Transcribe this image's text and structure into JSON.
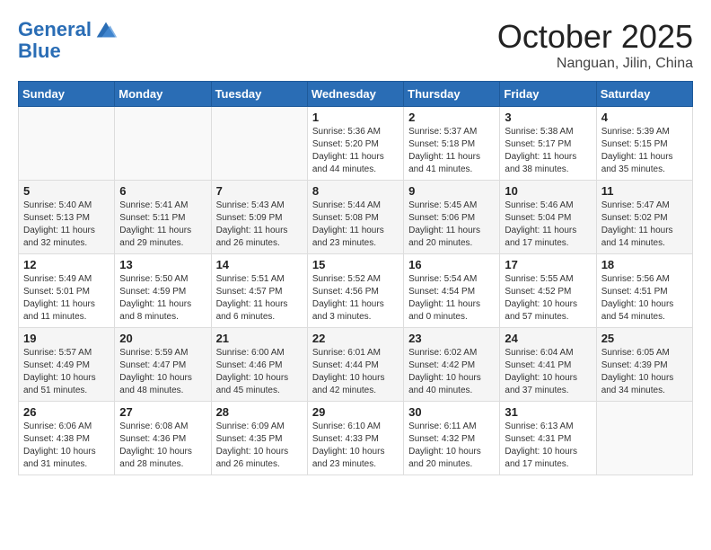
{
  "header": {
    "logo_line1": "General",
    "logo_line2": "Blue",
    "month": "October 2025",
    "location": "Nanguan, Jilin, China"
  },
  "weekdays": [
    "Sunday",
    "Monday",
    "Tuesday",
    "Wednesday",
    "Thursday",
    "Friday",
    "Saturday"
  ],
  "weeks": [
    [
      {
        "day": "",
        "info": ""
      },
      {
        "day": "",
        "info": ""
      },
      {
        "day": "",
        "info": ""
      },
      {
        "day": "1",
        "info": "Sunrise: 5:36 AM\nSunset: 5:20 PM\nDaylight: 11 hours\nand 44 minutes."
      },
      {
        "day": "2",
        "info": "Sunrise: 5:37 AM\nSunset: 5:18 PM\nDaylight: 11 hours\nand 41 minutes."
      },
      {
        "day": "3",
        "info": "Sunrise: 5:38 AM\nSunset: 5:17 PM\nDaylight: 11 hours\nand 38 minutes."
      },
      {
        "day": "4",
        "info": "Sunrise: 5:39 AM\nSunset: 5:15 PM\nDaylight: 11 hours\nand 35 minutes."
      }
    ],
    [
      {
        "day": "5",
        "info": "Sunrise: 5:40 AM\nSunset: 5:13 PM\nDaylight: 11 hours\nand 32 minutes."
      },
      {
        "day": "6",
        "info": "Sunrise: 5:41 AM\nSunset: 5:11 PM\nDaylight: 11 hours\nand 29 minutes."
      },
      {
        "day": "7",
        "info": "Sunrise: 5:43 AM\nSunset: 5:09 PM\nDaylight: 11 hours\nand 26 minutes."
      },
      {
        "day": "8",
        "info": "Sunrise: 5:44 AM\nSunset: 5:08 PM\nDaylight: 11 hours\nand 23 minutes."
      },
      {
        "day": "9",
        "info": "Sunrise: 5:45 AM\nSunset: 5:06 PM\nDaylight: 11 hours\nand 20 minutes."
      },
      {
        "day": "10",
        "info": "Sunrise: 5:46 AM\nSunset: 5:04 PM\nDaylight: 11 hours\nand 17 minutes."
      },
      {
        "day": "11",
        "info": "Sunrise: 5:47 AM\nSunset: 5:02 PM\nDaylight: 11 hours\nand 14 minutes."
      }
    ],
    [
      {
        "day": "12",
        "info": "Sunrise: 5:49 AM\nSunset: 5:01 PM\nDaylight: 11 hours\nand 11 minutes."
      },
      {
        "day": "13",
        "info": "Sunrise: 5:50 AM\nSunset: 4:59 PM\nDaylight: 11 hours\nand 8 minutes."
      },
      {
        "day": "14",
        "info": "Sunrise: 5:51 AM\nSunset: 4:57 PM\nDaylight: 11 hours\nand 6 minutes."
      },
      {
        "day": "15",
        "info": "Sunrise: 5:52 AM\nSunset: 4:56 PM\nDaylight: 11 hours\nand 3 minutes."
      },
      {
        "day": "16",
        "info": "Sunrise: 5:54 AM\nSunset: 4:54 PM\nDaylight: 11 hours\nand 0 minutes."
      },
      {
        "day": "17",
        "info": "Sunrise: 5:55 AM\nSunset: 4:52 PM\nDaylight: 10 hours\nand 57 minutes."
      },
      {
        "day": "18",
        "info": "Sunrise: 5:56 AM\nSunset: 4:51 PM\nDaylight: 10 hours\nand 54 minutes."
      }
    ],
    [
      {
        "day": "19",
        "info": "Sunrise: 5:57 AM\nSunset: 4:49 PM\nDaylight: 10 hours\nand 51 minutes."
      },
      {
        "day": "20",
        "info": "Sunrise: 5:59 AM\nSunset: 4:47 PM\nDaylight: 10 hours\nand 48 minutes."
      },
      {
        "day": "21",
        "info": "Sunrise: 6:00 AM\nSunset: 4:46 PM\nDaylight: 10 hours\nand 45 minutes."
      },
      {
        "day": "22",
        "info": "Sunrise: 6:01 AM\nSunset: 4:44 PM\nDaylight: 10 hours\nand 42 minutes."
      },
      {
        "day": "23",
        "info": "Sunrise: 6:02 AM\nSunset: 4:42 PM\nDaylight: 10 hours\nand 40 minutes."
      },
      {
        "day": "24",
        "info": "Sunrise: 6:04 AM\nSunset: 4:41 PM\nDaylight: 10 hours\nand 37 minutes."
      },
      {
        "day": "25",
        "info": "Sunrise: 6:05 AM\nSunset: 4:39 PM\nDaylight: 10 hours\nand 34 minutes."
      }
    ],
    [
      {
        "day": "26",
        "info": "Sunrise: 6:06 AM\nSunset: 4:38 PM\nDaylight: 10 hours\nand 31 minutes."
      },
      {
        "day": "27",
        "info": "Sunrise: 6:08 AM\nSunset: 4:36 PM\nDaylight: 10 hours\nand 28 minutes."
      },
      {
        "day": "28",
        "info": "Sunrise: 6:09 AM\nSunset: 4:35 PM\nDaylight: 10 hours\nand 26 minutes."
      },
      {
        "day": "29",
        "info": "Sunrise: 6:10 AM\nSunset: 4:33 PM\nDaylight: 10 hours\nand 23 minutes."
      },
      {
        "day": "30",
        "info": "Sunrise: 6:11 AM\nSunset: 4:32 PM\nDaylight: 10 hours\nand 20 minutes."
      },
      {
        "day": "31",
        "info": "Sunrise: 6:13 AM\nSunset: 4:31 PM\nDaylight: 10 hours\nand 17 minutes."
      },
      {
        "day": "",
        "info": ""
      }
    ]
  ]
}
